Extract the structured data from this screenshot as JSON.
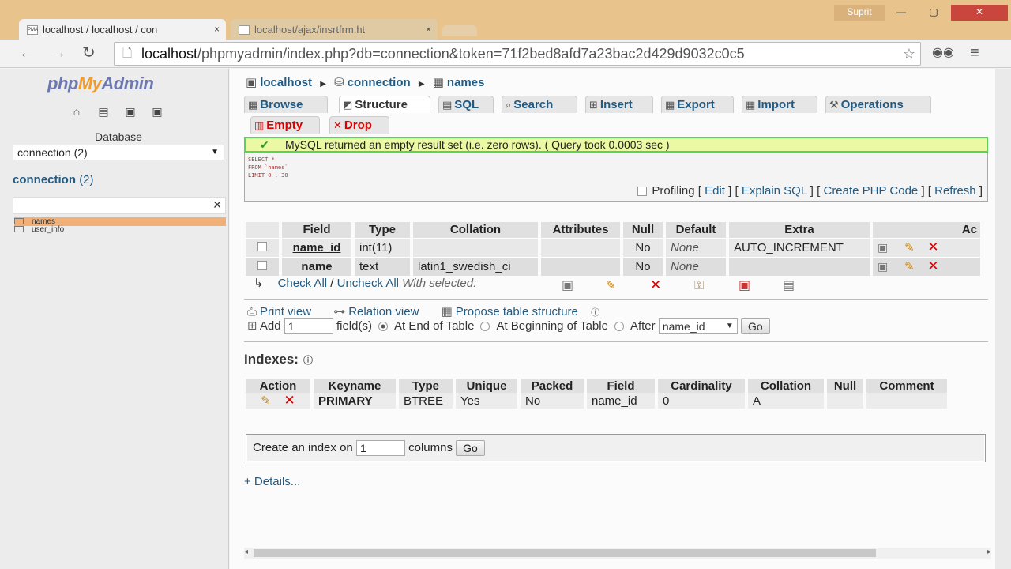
{
  "browser": {
    "tabs": [
      {
        "title": "localhost / localhost / con",
        "close": "×"
      },
      {
        "title": "localhost/ajax/insrtfrm.ht",
        "close": "×"
      }
    ],
    "user_label": "Suprit",
    "url_host": "localhost",
    "url_rest": "/phpmyadmin/index.php?db=connection&token=71f2bed8afd7a23bac2d429d9032c0c5"
  },
  "sidebar": {
    "logo_php": "php",
    "logo_my": "My",
    "logo_admin": "Admin",
    "database_label": "Database",
    "db_select": "connection (2)",
    "db_link": "connection",
    "db_count": "(2)",
    "tables": [
      "names",
      "user_info"
    ]
  },
  "breadcrumb": {
    "server": "localhost",
    "db": "connection",
    "table": "names"
  },
  "tabs": {
    "browse": "Browse",
    "structure": "Structure",
    "sql": "SQL",
    "search": "Search",
    "insert": "Insert",
    "export": "Export",
    "import": "Import",
    "operations": "Operations",
    "empty": "Empty",
    "drop": "Drop"
  },
  "message": "MySQL returned an empty result set (i.e. zero rows). ( Query took 0.0003 sec )",
  "sql": {
    "line1": "SELECT *",
    "line2": "FROM `names`",
    "line3": "LIMIT 0 , 30",
    "profiling": "Profiling",
    "edit": "Edit",
    "explain": "Explain SQL",
    "create_php": "Create PHP Code",
    "refresh": "Refresh"
  },
  "structure": {
    "headers": [
      "Field",
      "Type",
      "Collation",
      "Attributes",
      "Null",
      "Default",
      "Extra",
      "Ac"
    ],
    "rows": [
      {
        "field": "name_id",
        "type": "int(11)",
        "collation": "",
        "attributes": "",
        "null": "No",
        "default": "None",
        "extra": "AUTO_INCREMENT"
      },
      {
        "field": "name",
        "type": "text",
        "collation": "latin1_swedish_ci",
        "attributes": "",
        "null": "No",
        "default": "None",
        "extra": ""
      }
    ],
    "check_all": "Check All",
    "uncheck_all": "Uncheck All",
    "with_selected": "With selected:"
  },
  "links": {
    "print_view": "Print view",
    "relation_view": "Relation view",
    "propose": "Propose table structure"
  },
  "add_fields": {
    "label": "Add",
    "count": "1",
    "fields": "field(s)",
    "at_end": "At End of Table",
    "at_beginning": "At Beginning of Table",
    "after": "After",
    "after_field": "name_id",
    "go": "Go"
  },
  "indexes": {
    "title": "Indexes:",
    "headers": [
      "Action",
      "Keyname",
      "Type",
      "Unique",
      "Packed",
      "Field",
      "Cardinality",
      "Collation",
      "Null",
      "Comment"
    ],
    "row": {
      "keyname": "PRIMARY",
      "type": "BTREE",
      "unique": "Yes",
      "packed": "No",
      "field": "name_id",
      "cardinality": "0",
      "collation": "A",
      "null": "",
      "comment": ""
    }
  },
  "create_index": {
    "label": "Create an index on",
    "count": "1",
    "columns": "columns",
    "go": "Go"
  },
  "details": "+ Details..."
}
